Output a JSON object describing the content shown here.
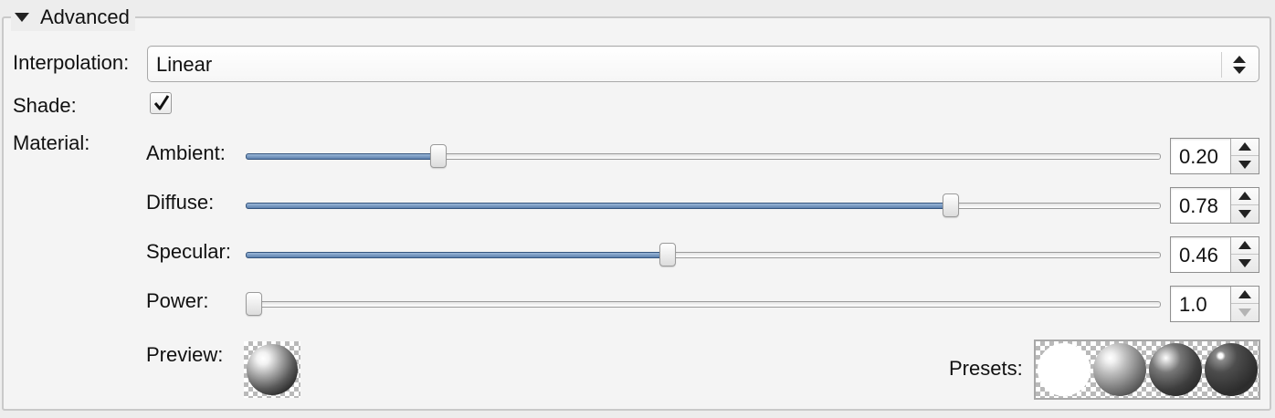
{
  "group": {
    "title": "Advanced",
    "collapse_icon": "triangle-down-icon"
  },
  "interpolation": {
    "label": "Interpolation:",
    "value": "Linear",
    "icon": "up-down-arrows-icon"
  },
  "shade": {
    "label": "Shade:",
    "checked": true,
    "icon": "checkmark-icon"
  },
  "material": {
    "label": "Material:",
    "properties": [
      {
        "label": "Ambient:",
        "value": "0.20",
        "fraction": 0.205,
        "filled": true
      },
      {
        "label": "Diffuse:",
        "value": "0.78",
        "fraction": 0.775,
        "filled": true
      },
      {
        "label": "Specular:",
        "value": "0.46",
        "fraction": 0.46,
        "filled": true
      },
      {
        "label": "Power:",
        "value": "1.0",
        "fraction": 0.0,
        "filled": false,
        "down_disabled": true
      }
    ]
  },
  "preview": {
    "label": "Preview:"
  },
  "presets": {
    "label": "Presets:",
    "count": 4
  },
  "colors": {
    "accent": "#5d80ae",
    "accent_border": "#35557e",
    "checker": "#b9b9b9"
  }
}
